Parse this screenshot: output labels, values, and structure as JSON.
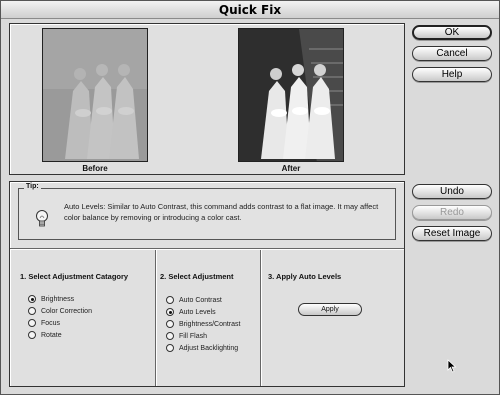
{
  "window": {
    "title": "Quick Fix"
  },
  "preview": {
    "before_label": "Before",
    "after_label": "After"
  },
  "buttons": {
    "ok": "OK",
    "cancel": "Cancel",
    "help": "Help",
    "undo": "Undo",
    "redo": "Redo",
    "reset": "Reset Image"
  },
  "tip": {
    "label": "Tip:",
    "text": "Auto Levels: Similar to Auto Contrast, this command adds contrast to a flat image. It may affect color balance by removing  or introducing a color cast."
  },
  "columns": {
    "category": {
      "heading": "1. Select Adjustment Catagory",
      "options": [
        {
          "label": "Brightness",
          "selected": true
        },
        {
          "label": "Color Correction",
          "selected": false
        },
        {
          "label": "Focus",
          "selected": false
        },
        {
          "label": "Rotate",
          "selected": false
        }
      ]
    },
    "adjustment": {
      "heading": "2. Select Adjustment",
      "options": [
        {
          "label": "Auto Contrast",
          "selected": false
        },
        {
          "label": "Auto Levels",
          "selected": true
        },
        {
          "label": "Brightness/Contrast",
          "selected": false
        },
        {
          "label": "Fill Flash",
          "selected": false
        },
        {
          "label": "Adjust Backlighting",
          "selected": false
        }
      ]
    },
    "apply": {
      "heading": "3. Apply Auto Levels",
      "button_label": "Apply"
    }
  },
  "icons": {
    "tip": "lightbulb-icon",
    "cursor": "arrow-cursor-icon"
  }
}
